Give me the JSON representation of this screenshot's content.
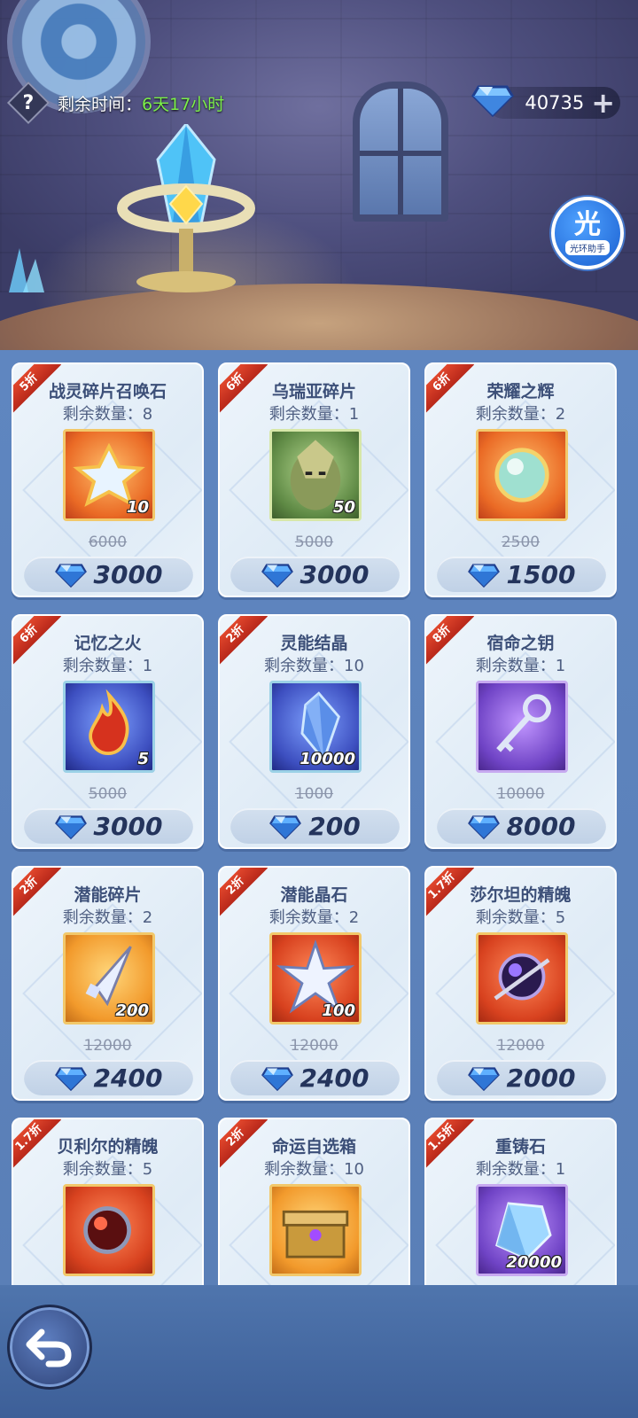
{
  "header": {
    "time_label": "剩余时间：",
    "time_value": "6天17小时",
    "currency_value": "40735",
    "assistant_big": "光",
    "assistant_small": "光环助手"
  },
  "items": [
    {
      "badge": "5折",
      "name": "战灵碎片召唤石",
      "stock": "剩余数量：8",
      "qty": "10",
      "orig": "6000",
      "price": "3000",
      "icon": "summon-stone-icon",
      "frame": "orange"
    },
    {
      "badge": "6折",
      "name": "乌瑞亚碎片",
      "stock": "剩余数量：1",
      "qty": "50",
      "orig": "5000",
      "price": "3000",
      "icon": "uria-shard-icon",
      "frame": "green"
    },
    {
      "badge": "6折",
      "name": "荣耀之辉",
      "stock": "剩余数量：2",
      "qty": "",
      "orig": "2500",
      "price": "1500",
      "icon": "glory-orb-icon",
      "frame": "orange"
    },
    {
      "badge": "6折",
      "name": "记忆之火",
      "stock": "剩余数量：1",
      "qty": "5",
      "orig": "5000",
      "price": "3000",
      "icon": "memory-flame-icon",
      "frame": "blue"
    },
    {
      "badge": "2折",
      "name": "灵能结晶",
      "stock": "剩余数量：10",
      "qty": "10000",
      "orig": "1000",
      "price": "200",
      "icon": "psionic-crystal-icon",
      "frame": "blue"
    },
    {
      "badge": "8折",
      "name": "宿命之钥",
      "stock": "剩余数量：1",
      "qty": "",
      "orig": "10000",
      "price": "8000",
      "icon": "destiny-key-icon",
      "frame": "purple"
    },
    {
      "badge": "2折",
      "name": "潜能碎片",
      "stock": "剩余数量：2",
      "qty": "200",
      "orig": "12000",
      "price": "2400",
      "icon": "potential-shard-icon",
      "frame": "gold"
    },
    {
      "badge": "2折",
      "name": "潜能晶石",
      "stock": "剩余数量：2",
      "qty": "100",
      "orig": "12000",
      "price": "2400",
      "icon": "potential-stone-icon",
      "frame": "red"
    },
    {
      "badge": "1.7折",
      "name": "莎尔坦的精魄",
      "stock": "剩余数量：5",
      "qty": "",
      "orig": "12000",
      "price": "2000",
      "icon": "spirit-orb-purple-icon",
      "frame": "red"
    },
    {
      "badge": "1.7折",
      "name": "贝利尔的精魄",
      "stock": "剩余数量：5",
      "qty": "",
      "orig": "",
      "price": "",
      "icon": "spirit-orb-red-icon",
      "frame": "red"
    },
    {
      "badge": "2折",
      "name": "命运自选箱",
      "stock": "剩余数量：10",
      "qty": "",
      "orig": "",
      "price": "",
      "icon": "fate-chest-icon",
      "frame": "gold"
    },
    {
      "badge": "1.5折",
      "name": "重铸石",
      "stock": "剩余数量：1",
      "qty": "20000",
      "orig": "",
      "price": "",
      "icon": "reforge-stone-icon",
      "frame": "purple"
    }
  ]
}
